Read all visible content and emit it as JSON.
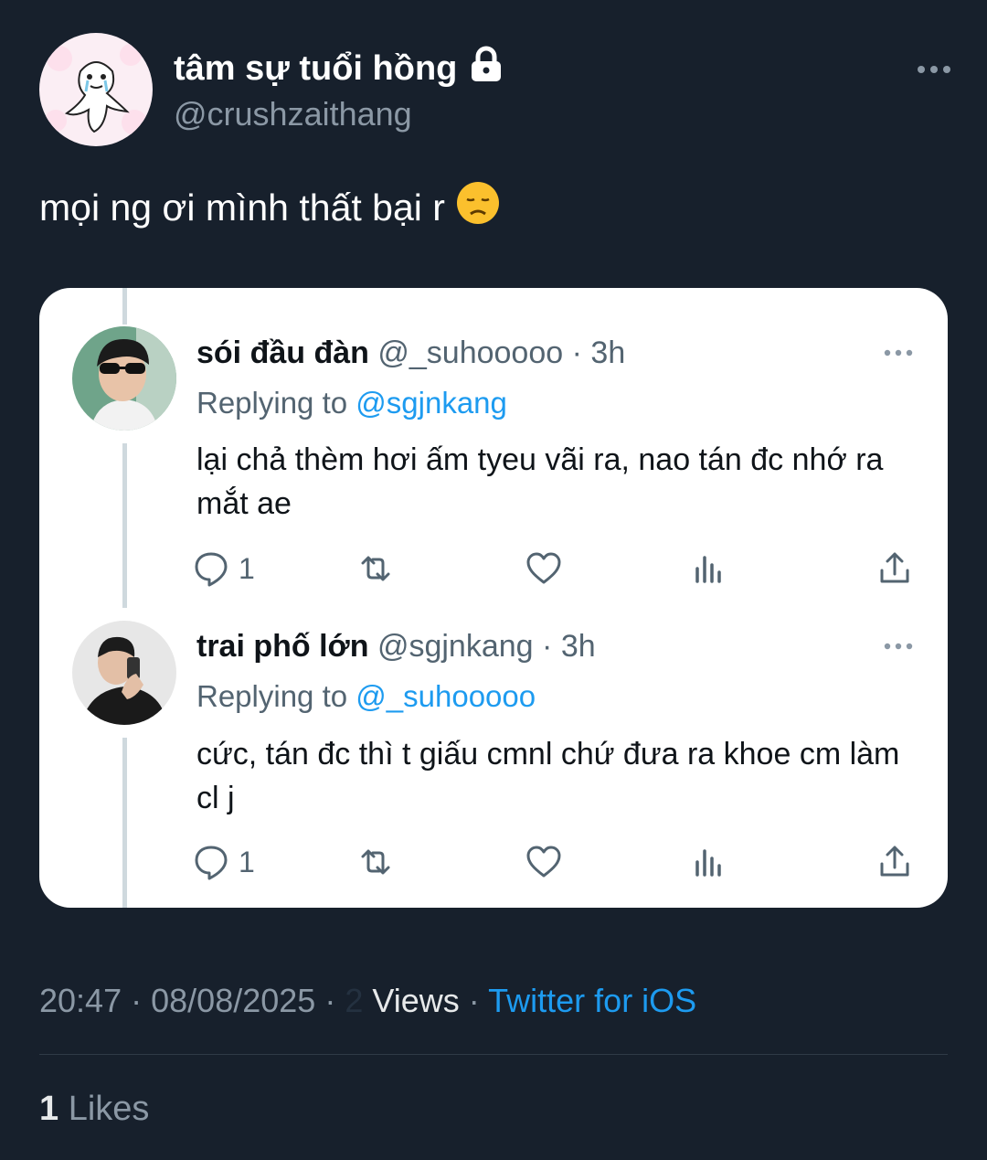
{
  "tweet": {
    "display_name": "tâm sự tuổi hồng",
    "handle": "@crushzaithang",
    "text": "mọi ng ơi mình thất bại r",
    "emoji": "😞",
    "time": "20:47",
    "date": "08/08/2025",
    "views_count": "2",
    "views_label": "Views",
    "source": "Twitter for iOS",
    "likes_count": "1",
    "likes_label": "Likes",
    "separator": "·"
  },
  "replies": [
    {
      "name": "sói đầu đàn",
      "handle": "@_suhooooo",
      "time": "3h",
      "replying_label": "Replying to",
      "replying_to": "@sgjnkang",
      "text": "lại chả thèm hơi ấm tyeu vãi ra, nao tán đc nhớ ra mắt ae",
      "reply_count": "1"
    },
    {
      "name": "trai phố lớn",
      "handle": "@sgjnkang",
      "time": "3h",
      "replying_label": "Replying to",
      "replying_to": "@_suhooooo",
      "text": "cức, tán đc thì t giấu cmnl chứ đưa ra khoe cm làm cl j",
      "reply_count": "1"
    }
  ],
  "icons": [
    "lock-icon",
    "more-icon",
    "reply-icon",
    "retweet-icon",
    "like-icon",
    "views-icon",
    "share-icon"
  ],
  "colors": {
    "background": "#17202c",
    "accent": "#1d9bf0",
    "muted": "#8b98a5",
    "card": "#ffffff"
  }
}
